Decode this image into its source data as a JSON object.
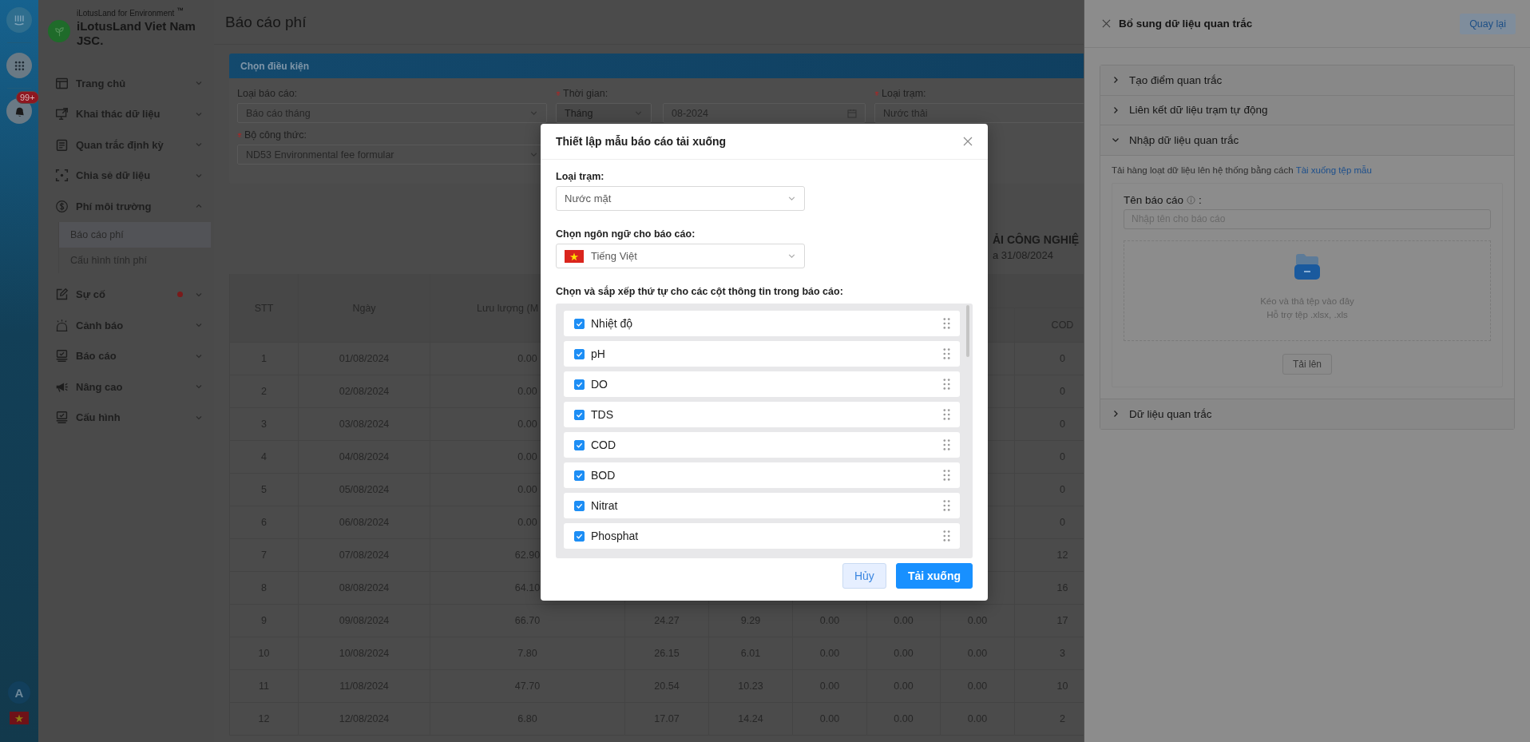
{
  "rail": {
    "notification_count": "99+",
    "avatar": "A"
  },
  "sidebar": {
    "tagline": "iLotusLand for Environment $^{™}$",
    "company": "iLotusLand Viet Nam JSC.",
    "items": [
      {
        "label": "Trang chủ",
        "expanded": false,
        "has_alert": false
      },
      {
        "label": "Khai thác dữ liệu",
        "expanded": false,
        "has_alert": false
      },
      {
        "label": "Quan trắc định kỳ",
        "expanded": false,
        "has_alert": false
      },
      {
        "label": "Chia sẻ dữ liệu",
        "expanded": false,
        "has_alert": false
      },
      {
        "label": "Phí môi trường",
        "expanded": true,
        "has_alert": false,
        "children": [
          {
            "label": "Báo cáo phí",
            "selected": true
          },
          {
            "label": "Cấu hình tính phí",
            "selected": false
          }
        ]
      },
      {
        "label": "Sự cố",
        "expanded": false,
        "has_alert": true
      },
      {
        "label": "Cảnh báo",
        "expanded": false,
        "has_alert": false
      },
      {
        "label": "Báo cáo",
        "expanded": false,
        "has_alert": false
      },
      {
        "label": "Nâng cao",
        "expanded": false,
        "has_alert": false
      },
      {
        "label": "Cấu hình",
        "expanded": false,
        "has_alert": false
      }
    ]
  },
  "page": {
    "title": "Báo cáo phí"
  },
  "filters": {
    "title": "Chọn điều kiện",
    "fields": [
      {
        "kind": "select",
        "label": "Loại báo cáo:",
        "required": false,
        "value": "Báo cáo tháng"
      },
      {
        "kind": "period",
        "label": "Thời gian:",
        "required": true,
        "value": "Tháng",
        "disabled": true,
        "date": "08-2024"
      },
      {
        "kind": "select",
        "label": "Loại trạm:",
        "required": true,
        "value": "Nước thải"
      },
      {
        "kind": "select",
        "label": "Bộ công thức:",
        "required": true,
        "value": "ND53 Environmental fee formular"
      }
    ]
  },
  "report": {
    "title": "ẢI CÔNG NGHIỆ",
    "subtitle": "a 31/08/2024"
  },
  "table": {
    "columns": [
      "STT",
      "Ngày",
      "Lưu lượng (M",
      null,
      null,
      null,
      null,
      null,
      "COD"
    ],
    "rows": [
      [
        "1",
        "01/08/2024",
        "0.00",
        null,
        null,
        null,
        null,
        null,
        "0"
      ],
      [
        "2",
        "02/08/2024",
        "0.00",
        null,
        null,
        null,
        null,
        null,
        "0"
      ],
      [
        "3",
        "03/08/2024",
        "0.00",
        null,
        null,
        null,
        null,
        null,
        "0"
      ],
      [
        "4",
        "04/08/2024",
        "0.00",
        null,
        null,
        null,
        null,
        null,
        "0"
      ],
      [
        "5",
        "05/08/2024",
        "0.00",
        null,
        null,
        null,
        null,
        null,
        "0"
      ],
      [
        "6",
        "06/08/2024",
        "0.00",
        null,
        null,
        null,
        null,
        null,
        "0"
      ],
      [
        "7",
        "07/08/2024",
        "62.90",
        null,
        null,
        null,
        null,
        null,
        "12"
      ],
      [
        "8",
        "08/08/2024",
        "64.10",
        null,
        null,
        null,
        null,
        null,
        "16"
      ],
      [
        "9",
        "09/08/2024",
        "66.70",
        "24.27",
        "9.29",
        "0.00",
        "0.00",
        "0.00",
        "17"
      ],
      [
        "10",
        "10/08/2024",
        "7.80",
        "26.15",
        "6.01",
        "0.00",
        "0.00",
        "0.00",
        "3"
      ],
      [
        "11",
        "11/08/2024",
        "47.70",
        "20.54",
        "10.23",
        "0.00",
        "0.00",
        "0.00",
        "10"
      ],
      [
        "12",
        "12/08/2024",
        "6.80",
        "17.07",
        "14.24",
        "0.00",
        "0.00",
        "0.00",
        "2"
      ]
    ]
  },
  "drawer": {
    "title": "Bổ sung dữ liệu quan trắc",
    "back_button": "Quay lại",
    "panels": [
      {
        "title": "Tạo điểm quan trắc",
        "expanded": false
      },
      {
        "title": "Liên kết dữ liệu trạm tự động",
        "expanded": false
      },
      {
        "title": "Nhập dữ liệu quan trắc",
        "expanded": true,
        "content": {
          "hint": "Tải hàng loạt dữ liệu lên hệ thống bằng cách",
          "link": "Tài xuống tệp mẫu",
          "name_label": "Tên báo cáo",
          "name_suffix": ":",
          "placeholder": "Nhập tên cho báo cáo",
          "drop_title": "Kéo và thả tệp vào đây",
          "drop_hint": "Hỗ trợ tệp .xlsx, .xls",
          "upload_button": {
            "label": "Tải lên",
            "disabled": true
          }
        }
      },
      {
        "title": "Dữ liệu quan trắc",
        "expanded": false
      }
    ]
  },
  "modal": {
    "title": "Thiết lập mẫu báo cáo tải xuống",
    "station_label": "Loại trạm:",
    "station_value": "Nước mặt",
    "language_label": "Chọn ngôn ngữ cho báo cáo:",
    "language_value": "Tiếng Việt",
    "columns_label": "Chọn và sắp xếp thứ tự cho các cột thông tin trong báo cáo:",
    "columns": [
      {
        "label": "Nhiệt độ",
        "checked": true
      },
      {
        "label": "pH",
        "checked": true
      },
      {
        "label": "DO",
        "checked": true
      },
      {
        "label": "TDS",
        "checked": true
      },
      {
        "label": "COD",
        "checked": true
      },
      {
        "label": "BOD",
        "checked": true
      },
      {
        "label": "Nitrat",
        "checked": true
      },
      {
        "label": "Phosphat",
        "checked": true
      }
    ],
    "buttons": [
      {
        "label": "Hủy",
        "kind": "secondary"
      },
      {
        "label": "Tải xuống",
        "kind": "primary"
      }
    ]
  }
}
